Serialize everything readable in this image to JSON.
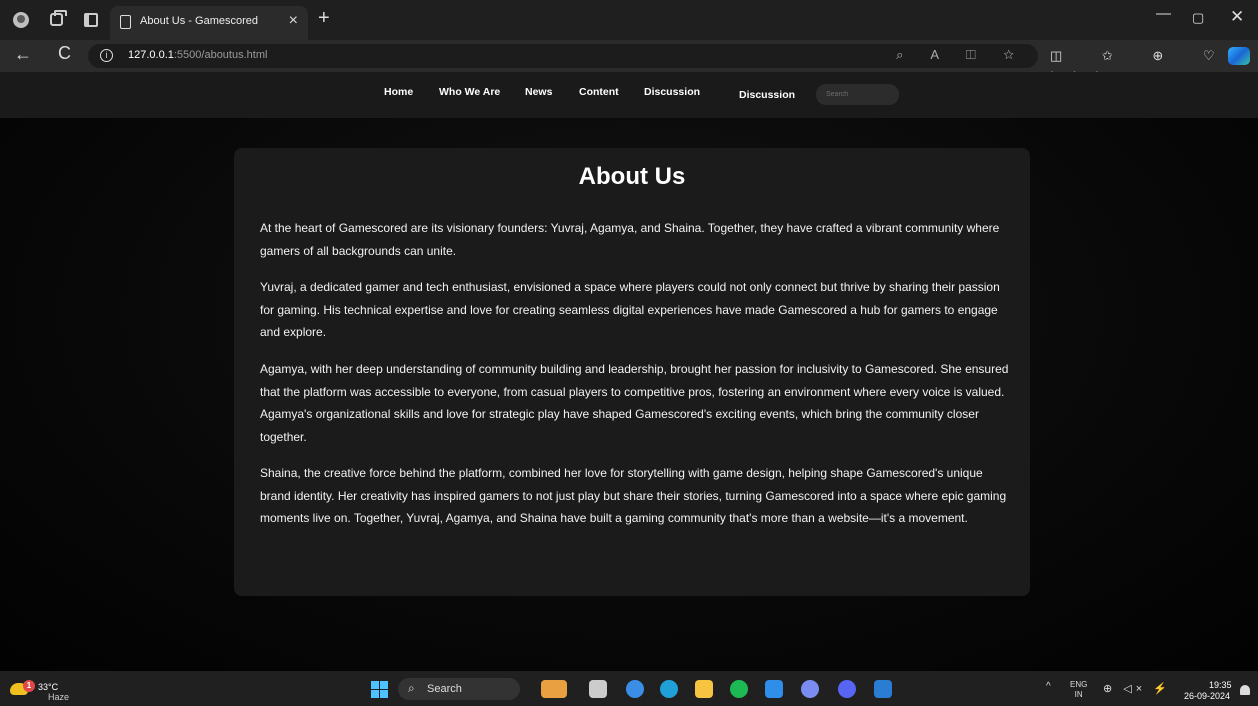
{
  "browser": {
    "tab_title": "About Us - Gamescored",
    "tab_close": "×",
    "new_tab": "+",
    "url_host": "127.0.0.1",
    "url_path": ":5500/aboutus.html",
    "info_glyph": "i",
    "back": "←",
    "reload": "C",
    "omnibox_icons": "⌕ A ◫ ☆",
    "toolbar_icons": "◫ ✩ ⊕ ♡ ···",
    "window_min": "—",
    "window_max": "▢",
    "window_close": "✕",
    "icons": [
      "profile-icon",
      "workspaces-icon",
      "vertical-tabs-icon",
      "page-icon",
      "zoom-icon",
      "read-aloud-icon",
      "immersive-reader-icon",
      "favorite-icon",
      "split-screen-icon",
      "favorites-icon",
      "collections-icon",
      "browser-essentials-icon",
      "more-icon",
      "copilot-icon"
    ]
  },
  "site": {
    "nav": [
      "Home",
      "Who We Are",
      "News",
      "Content",
      "Discussion",
      "Discussion"
    ],
    "search_placeholder": "Search"
  },
  "about": {
    "title": "About Us",
    "paragraphs": [
      "At the heart of Gamescored are its visionary founders: Yuvraj, Agamya, and Shaina. Together, they have crafted a vibrant community where gamers of all backgrounds can unite.",
      "Yuvraj, a dedicated gamer and tech enthusiast, envisioned a space where players could not only connect but thrive by sharing their passion for gaming. His technical expertise and love for creating seamless digital experiences have made Gamescored a hub for gamers to engage and explore.",
      "Agamya, with her deep understanding of community building and leadership, brought her passion for inclusivity to Gamescored. She ensured that the platform was accessible to everyone, from casual players to competitive pros, fostering an environment where every voice is valued. Agamya's organizational skills and love for strategic play have shaped Gamescored's exciting events, which bring the community closer together.",
      "Shaina, the creative force behind the platform, combined her love for storytelling with game design, helping shape Gamescored's unique brand identity. Her creativity has inspired gamers to not just play but share their stories, turning Gamescored into a space where epic gaming moments live on. Together, Yuvraj, Agamya, and Shaina have built a gaming community that's more than a website—it's a movement."
    ]
  },
  "taskbar": {
    "weather_temp": "33°C",
    "weather_condition": "Haze",
    "weather_badge": "1",
    "search_label": "Search",
    "search_glyph": "⌕",
    "tray_up": "^",
    "lang_line1": "ENG",
    "lang_line2": "IN",
    "tray_glyphs": "⊕ ◁× ⚡",
    "time": "19:35",
    "date": "26-09-2024",
    "apps": [
      {
        "name": "widgets-icon",
        "color": "#e8a040"
      },
      {
        "name": "task-view-icon",
        "color": "#cccccc"
      },
      {
        "name": "copilot-icon",
        "color": "#3a8ee6"
      },
      {
        "name": "edge-icon",
        "color": "#1fa0d8"
      },
      {
        "name": "file-explorer-icon",
        "color": "#f5c542"
      },
      {
        "name": "spotify-icon",
        "color": "#1db954"
      },
      {
        "name": "vscode-icon",
        "color": "#2f8ee8"
      },
      {
        "name": "gemini-icon",
        "color": "#7b8cf0"
      },
      {
        "name": "discord-icon",
        "color": "#5865f2"
      },
      {
        "name": "word-icon",
        "color": "#2b7cd3"
      }
    ]
  }
}
